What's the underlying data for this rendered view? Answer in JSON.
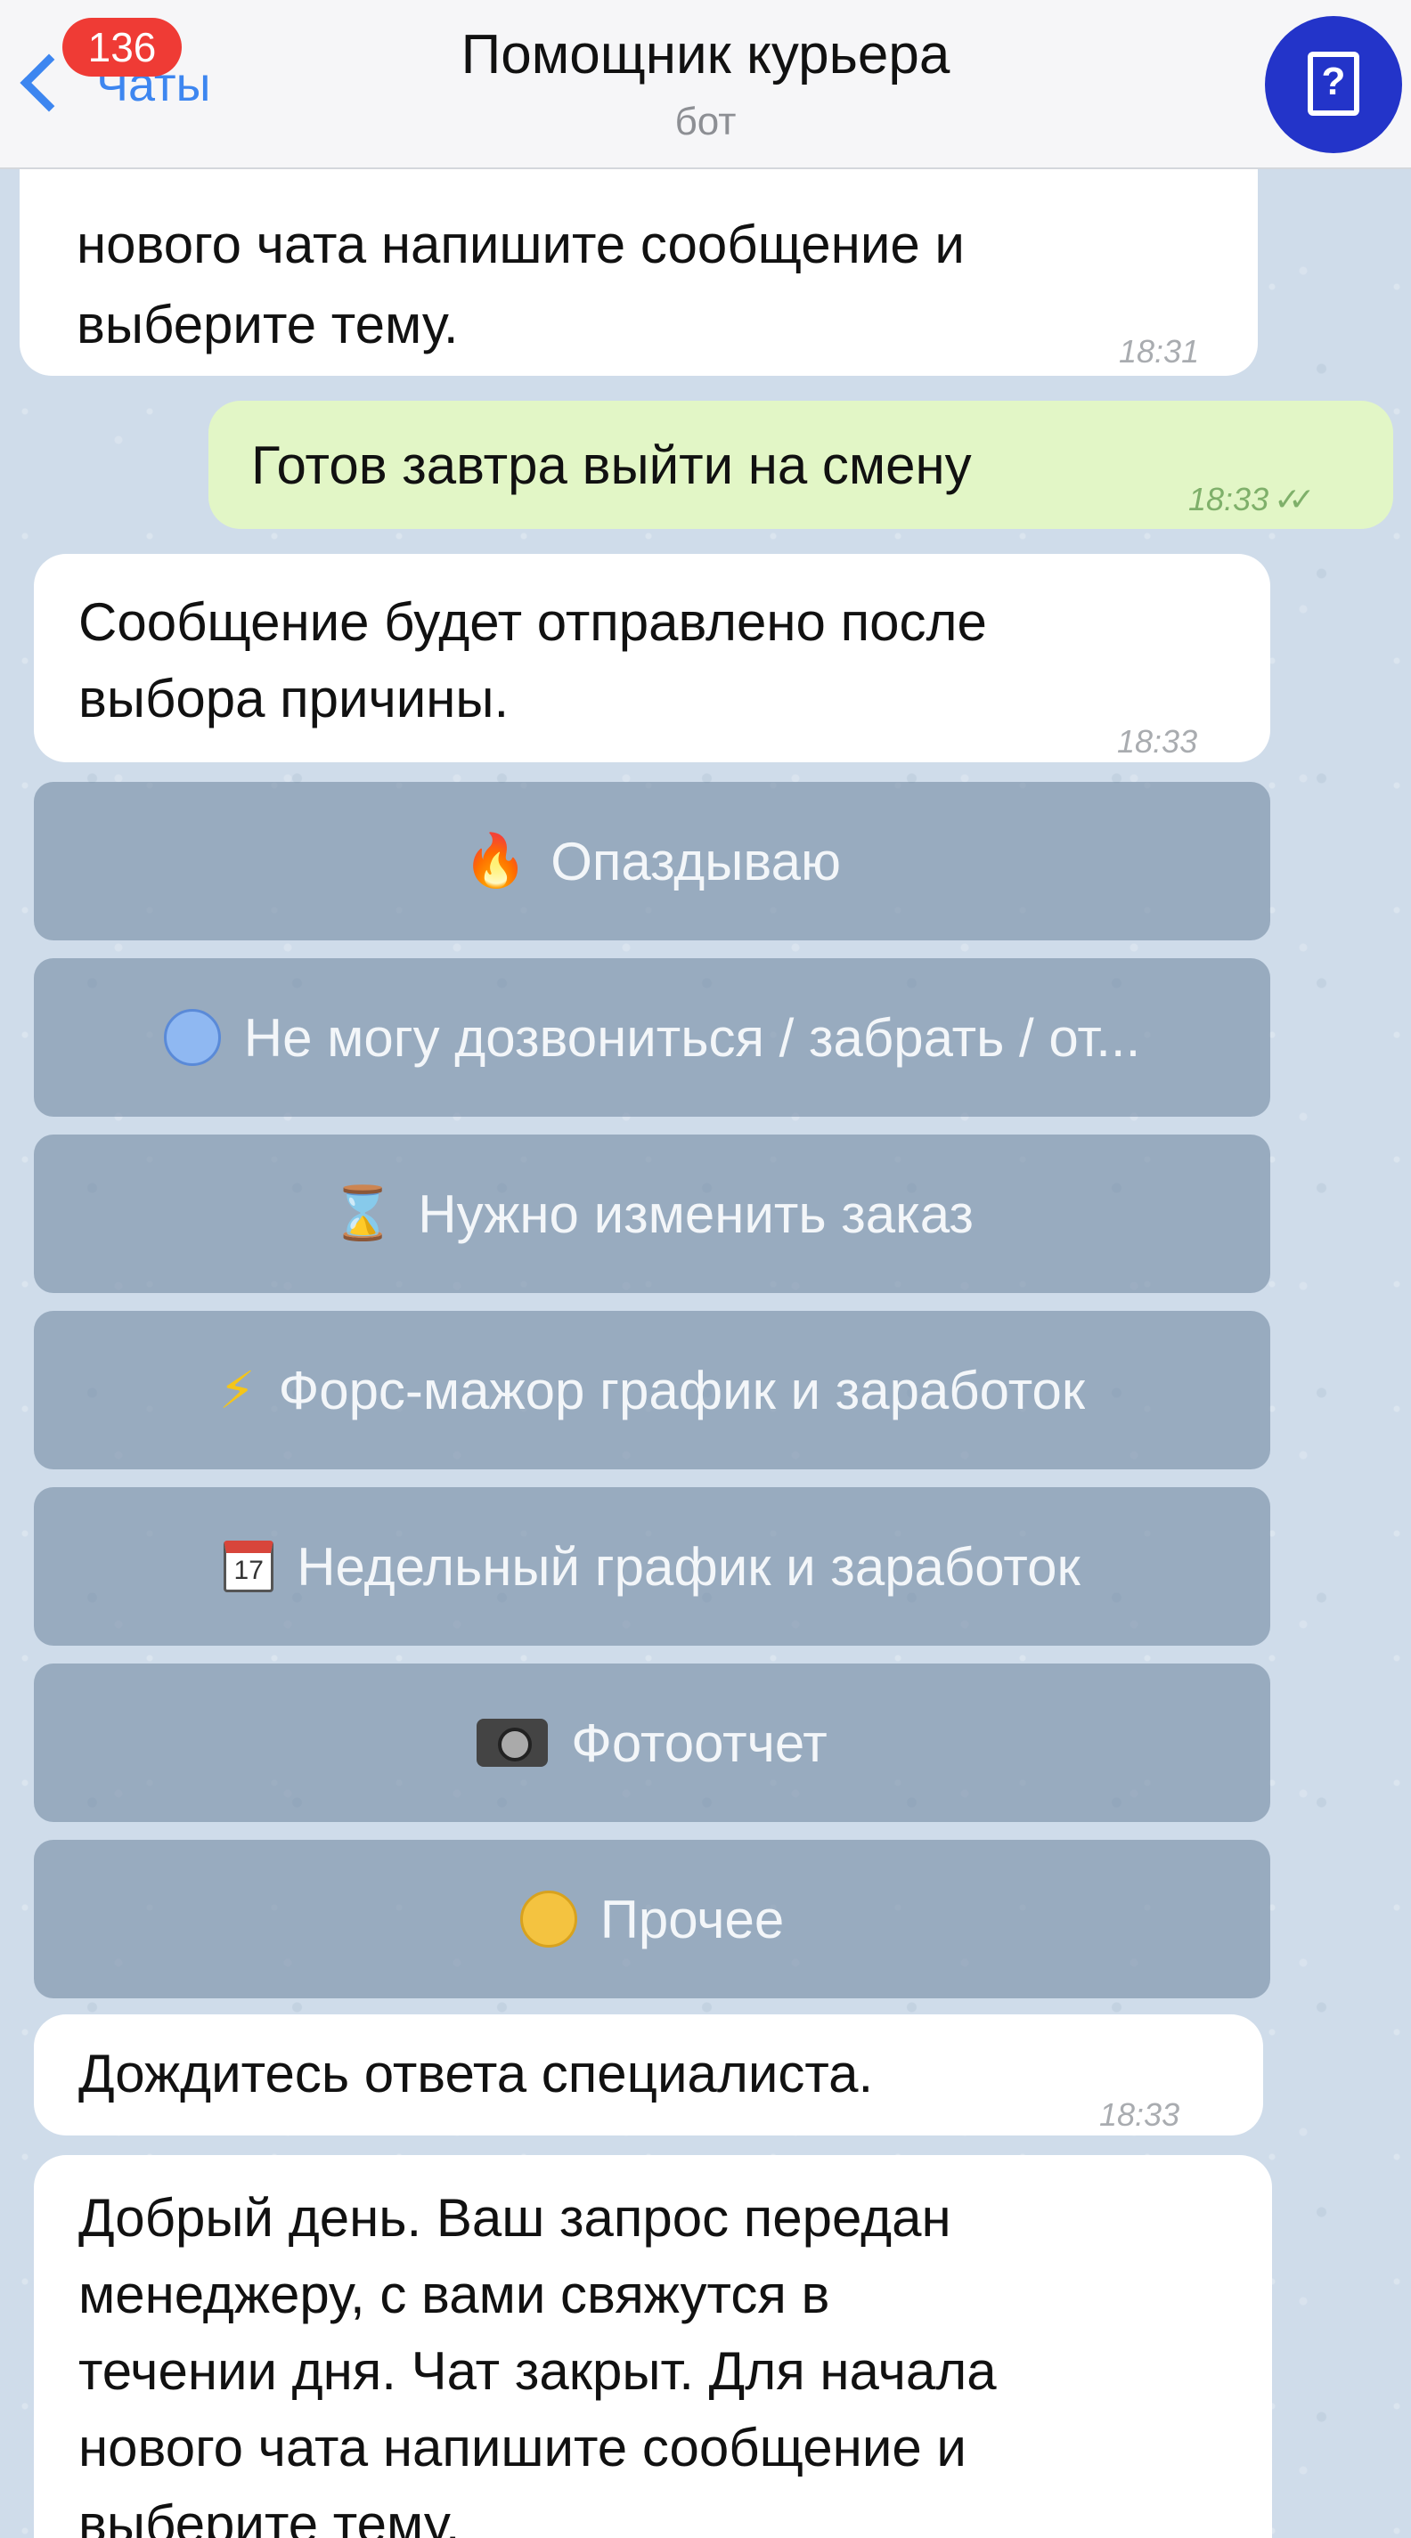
{
  "header": {
    "back_label": "Чаты",
    "unread_count": "136",
    "title": "Помощник курьера",
    "subtitle": "бот",
    "avatar_icon": "book-question-icon",
    "avatar_glyph": "?"
  },
  "messages": [
    {
      "id": "m1",
      "direction": "incoming",
      "lines": [
        "нового чата напишите сообщение и",
        "выберите тему."
      ],
      "time": "18:31"
    },
    {
      "id": "m2",
      "direction": "outgoing",
      "lines": [
        "Готов завтра выйти на смену"
      ],
      "time": "18:33",
      "status": "read",
      "check_glyph": "✓✓"
    },
    {
      "id": "m3",
      "direction": "incoming",
      "lines": [
        "Сообщение будет отправлено после",
        "выбора причины."
      ],
      "time": "18:33"
    },
    {
      "id": "m4",
      "direction": "incoming",
      "lines": [
        "Дождитесь ответа специалиста."
      ],
      "time": "18:33"
    },
    {
      "id": "m5",
      "direction": "incoming",
      "lines": [
        "Добрый день. Ваш запрос передан",
        "менеджеру, с вами свяжутся в",
        "течении дня. Чат закрыт. Для начала",
        "нового чата напишите сообщение и",
        "выберите тему."
      ]
    }
  ],
  "keyboard": [
    {
      "icon": "fire-icon",
      "glyph": "🔥",
      "label": "Опаздываю"
    },
    {
      "icon": "cold-face-icon",
      "label": "Не могу дозвониться / забрать / от..."
    },
    {
      "icon": "hourglass-icon",
      "glyph": "⌛",
      "label": "Нужно изменить заказ"
    },
    {
      "icon": "lightning-icon",
      "glyph": "⚡",
      "label": "Форс-мажор график и заработок"
    },
    {
      "icon": "calendar-icon",
      "glyph": "17",
      "label": "Недельный график и заработок"
    },
    {
      "icon": "camera-flash-icon",
      "label": "Фотоотчет"
    },
    {
      "icon": "sleepy-face-icon",
      "label": "Прочее"
    }
  ],
  "colors": {
    "accent": "#3d86f0",
    "badge": "#ef3b35",
    "outgoing_bubble": "#e2f6c6",
    "incoming_bubble": "#ffffff",
    "keyboard_button": "#768ca4",
    "avatar": "#2334c9"
  }
}
